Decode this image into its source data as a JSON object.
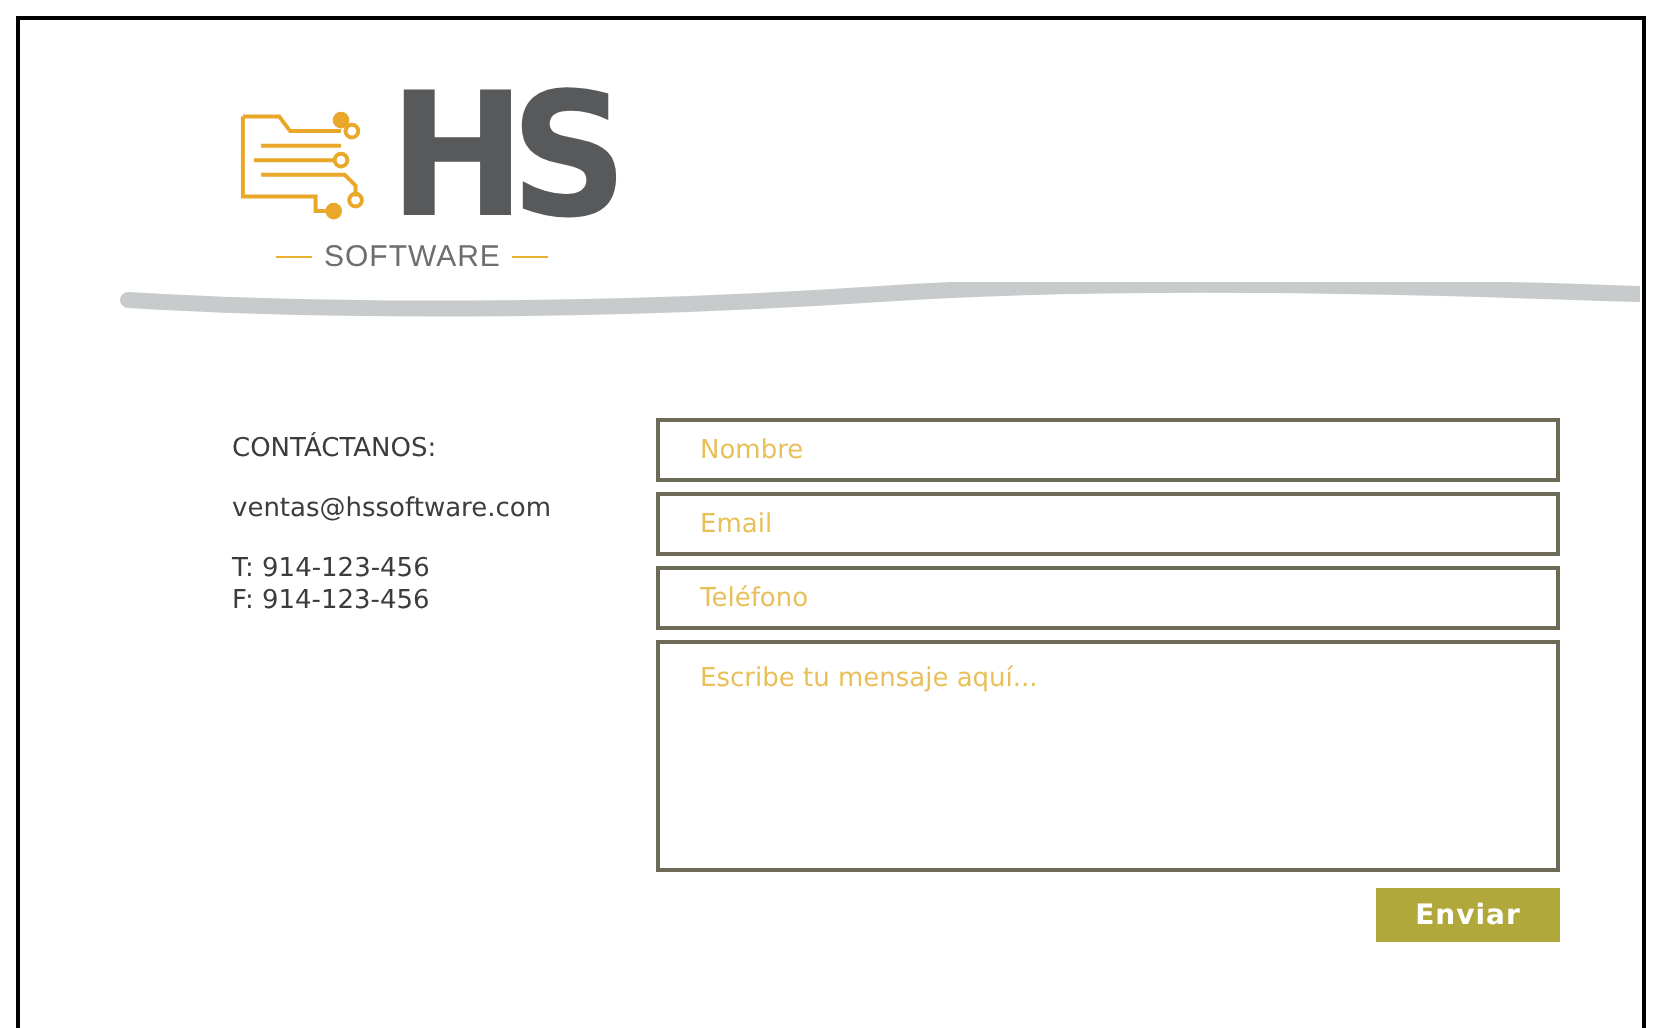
{
  "logo": {
    "letters": "HS",
    "wordmark": "SOFTWARE"
  },
  "contact": {
    "heading": "CONTÁCTANOS:",
    "email": "ventas@hssoftware.com",
    "phones": [
      "T: 914-123-456",
      "F: 914-123-456"
    ]
  },
  "form": {
    "fields": [
      {
        "kind": "line",
        "placeholder": "Nombre"
      },
      {
        "kind": "line",
        "placeholder": "Email"
      },
      {
        "kind": "line",
        "placeholder": "Teléfono"
      },
      {
        "kind": "area",
        "placeholder": "Escribe tu mensaje aquí..."
      }
    ],
    "submit": "Enviar"
  }
}
